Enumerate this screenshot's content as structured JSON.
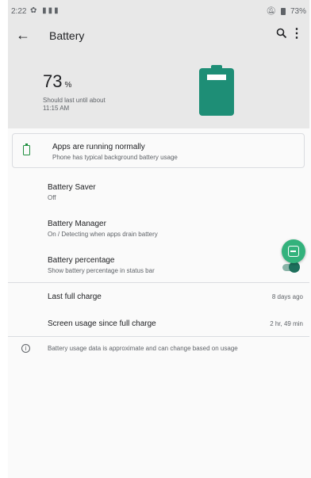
{
  "status_bar": {
    "time": "2:22",
    "left_icons": "✿ ▮▮▮",
    "mute_icon": "no-notifications-icon",
    "battery_percent": "73%"
  },
  "app_bar": {
    "back_icon": "arrow-left-icon",
    "title": "Battery",
    "search_icon": "search-icon",
    "more_icon": "more-vert-icon"
  },
  "hero": {
    "percent_value": "73",
    "percent_unit": "%",
    "estimate_line1": "Should last until about",
    "estimate_line2": "11:15 AM",
    "battery_level": 0.73,
    "battery_color": "#1e8e76"
  },
  "status_card": {
    "title": "Apps are running normally",
    "subtitle": "Phone has typical background battery usage"
  },
  "settings": [
    {
      "label": "Battery Saver",
      "desc": "Off"
    },
    {
      "label": "Battery Manager",
      "desc": "On / Detecting when apps drain battery"
    },
    {
      "label": "Battery percentage",
      "desc": "Show battery percentage in status bar",
      "toggle": true
    }
  ],
  "stats": [
    {
      "label": "Last full charge",
      "value": "8 days ago"
    },
    {
      "label": "Screen usage since full charge",
      "value": "2 hr, 49 min"
    }
  ],
  "footnote": "Battery usage data is approximate and can change based on usage",
  "colors": {
    "accent": "#1e8e76",
    "fab": "#33b27c",
    "header_bg": "#e8e8e8"
  }
}
